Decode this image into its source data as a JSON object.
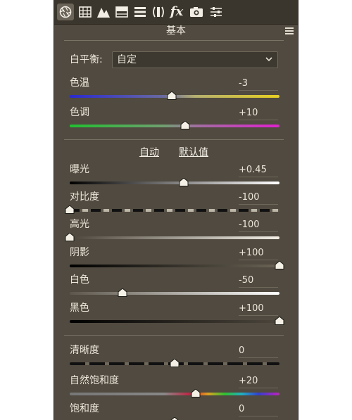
{
  "toolbar": {
    "tools": [
      {
        "icon": "aperture-icon"
      },
      {
        "icon": "grid-icon"
      },
      {
        "icon": "mountains-icon"
      },
      {
        "icon": "split-panel-icon"
      },
      {
        "icon": "hsl-bars-icon"
      },
      {
        "icon": "lens-icon"
      },
      {
        "icon": "fx-icon",
        "text": "fx"
      },
      {
        "icon": "camera-icon"
      },
      {
        "icon": "presets-sliders-icon"
      }
    ]
  },
  "panel": {
    "title": "基本",
    "white_balance": {
      "label": "白平衡:",
      "value": "自定"
    },
    "auto_label": "自动",
    "default_label": "默认值",
    "sliders": [
      {
        "id": "temperature",
        "label": "色温",
        "value": "-3",
        "fraction": 0.485,
        "track": "temperature"
      },
      {
        "id": "tint",
        "label": "色调",
        "value": "+10",
        "fraction": 0.55,
        "track": "tint"
      },
      {
        "id": "exposure",
        "label": "曝光",
        "value": "+0.45",
        "fraction": 0.545,
        "track": "exposure"
      },
      {
        "id": "contrast",
        "label": "对比度",
        "value": "-100",
        "fraction": 0.0,
        "track": "contrast"
      },
      {
        "id": "highlights",
        "label": "高光",
        "value": "-100",
        "fraction": 0.0,
        "track": "highlights"
      },
      {
        "id": "shadows",
        "label": "阴影",
        "value": "+100",
        "fraction": 1.0,
        "track": "shadows"
      },
      {
        "id": "whites",
        "label": "白色",
        "value": "-50",
        "fraction": 0.25,
        "track": "whites"
      },
      {
        "id": "blacks",
        "label": "黑色",
        "value": "+100",
        "fraction": 1.0,
        "track": "blacks"
      },
      {
        "id": "clarity",
        "label": "清晰度",
        "value": "0",
        "fraction": 0.5,
        "track": "clarity"
      },
      {
        "id": "vibrance",
        "label": "自然饱和度",
        "value": "+20",
        "fraction": 0.6,
        "track": "vibrance"
      },
      {
        "id": "saturation",
        "label": "饱和度",
        "value": "0",
        "fraction": 0.5,
        "track": "saturation"
      }
    ]
  },
  "colors": {
    "panel_bg": "#504a40",
    "toolbar_bg": "#3a352d",
    "text": "#ece6da"
  }
}
